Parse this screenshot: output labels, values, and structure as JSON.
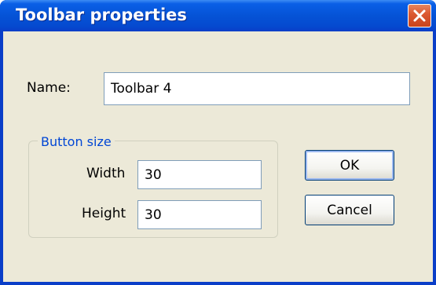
{
  "window": {
    "title": "Toolbar properties"
  },
  "form": {
    "name_label": "Name:",
    "name_value": "Toolbar 4",
    "group_label": "Button size",
    "width_label": "Width",
    "width_value": "30",
    "height_label": "Height",
    "height_value": "30"
  },
  "buttons": {
    "ok": "OK",
    "cancel": "Cancel"
  },
  "icons": {
    "close": "close-icon"
  }
}
